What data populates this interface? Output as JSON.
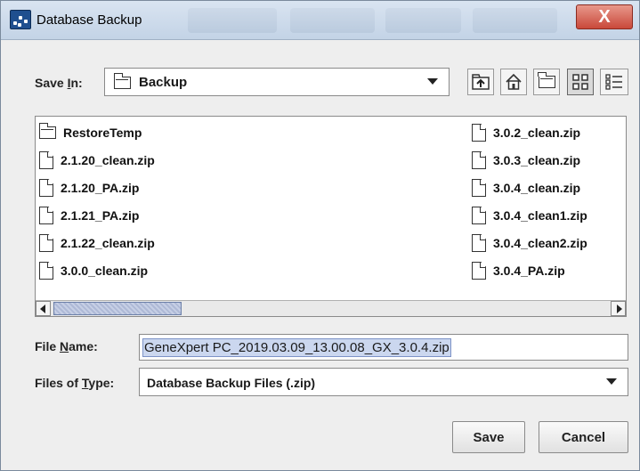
{
  "window": {
    "title": "Database Backup",
    "close_glyph": "X"
  },
  "save_in": {
    "label_pre": "Save ",
    "label_mnemonic": "I",
    "label_post": "n:",
    "value": "Backup"
  },
  "toolbar": {
    "icons": [
      "up-one-level-icon",
      "home-icon",
      "new-folder-icon",
      "list-view-icon",
      "details-view-icon"
    ]
  },
  "files": {
    "left_column": [
      {
        "name": "RestoreTemp",
        "type": "folder"
      },
      {
        "name": "2.1.20_clean.zip",
        "type": "file"
      },
      {
        "name": "2.1.20_PA.zip",
        "type": "file"
      },
      {
        "name": "2.1.21_PA.zip",
        "type": "file"
      },
      {
        "name": "2.1.22_clean.zip",
        "type": "file"
      },
      {
        "name": "3.0.0_clean.zip",
        "type": "file"
      }
    ],
    "right_column": [
      {
        "name": "3.0.2_clean.zip",
        "type": "file"
      },
      {
        "name": "3.0.3_clean.zip",
        "type": "file"
      },
      {
        "name": "3.0.4_clean.zip",
        "type": "file"
      },
      {
        "name": "3.0.4_clean1.zip",
        "type": "file"
      },
      {
        "name": "3.0.4_clean2.zip",
        "type": "file"
      },
      {
        "name": "3.0.4_PA.zip",
        "type": "file"
      }
    ]
  },
  "file_name": {
    "label_pre": "File ",
    "label_mnemonic": "N",
    "label_post": "ame:",
    "value": "GeneXpert PC_2019.03.09_13.00.08_GX_3.0.4.zip"
  },
  "file_type": {
    "label_pre": "Files of ",
    "label_mnemonic": "T",
    "label_post": "ype:",
    "value": "Database Backup Files (.zip)"
  },
  "buttons": {
    "save": "Save",
    "cancel": "Cancel"
  },
  "colors": {
    "title_bar": "#c3d3e6",
    "close_button": "#c9483a",
    "selection": "#cbd7ef",
    "scroll_thumb": "#aeb9d6"
  }
}
